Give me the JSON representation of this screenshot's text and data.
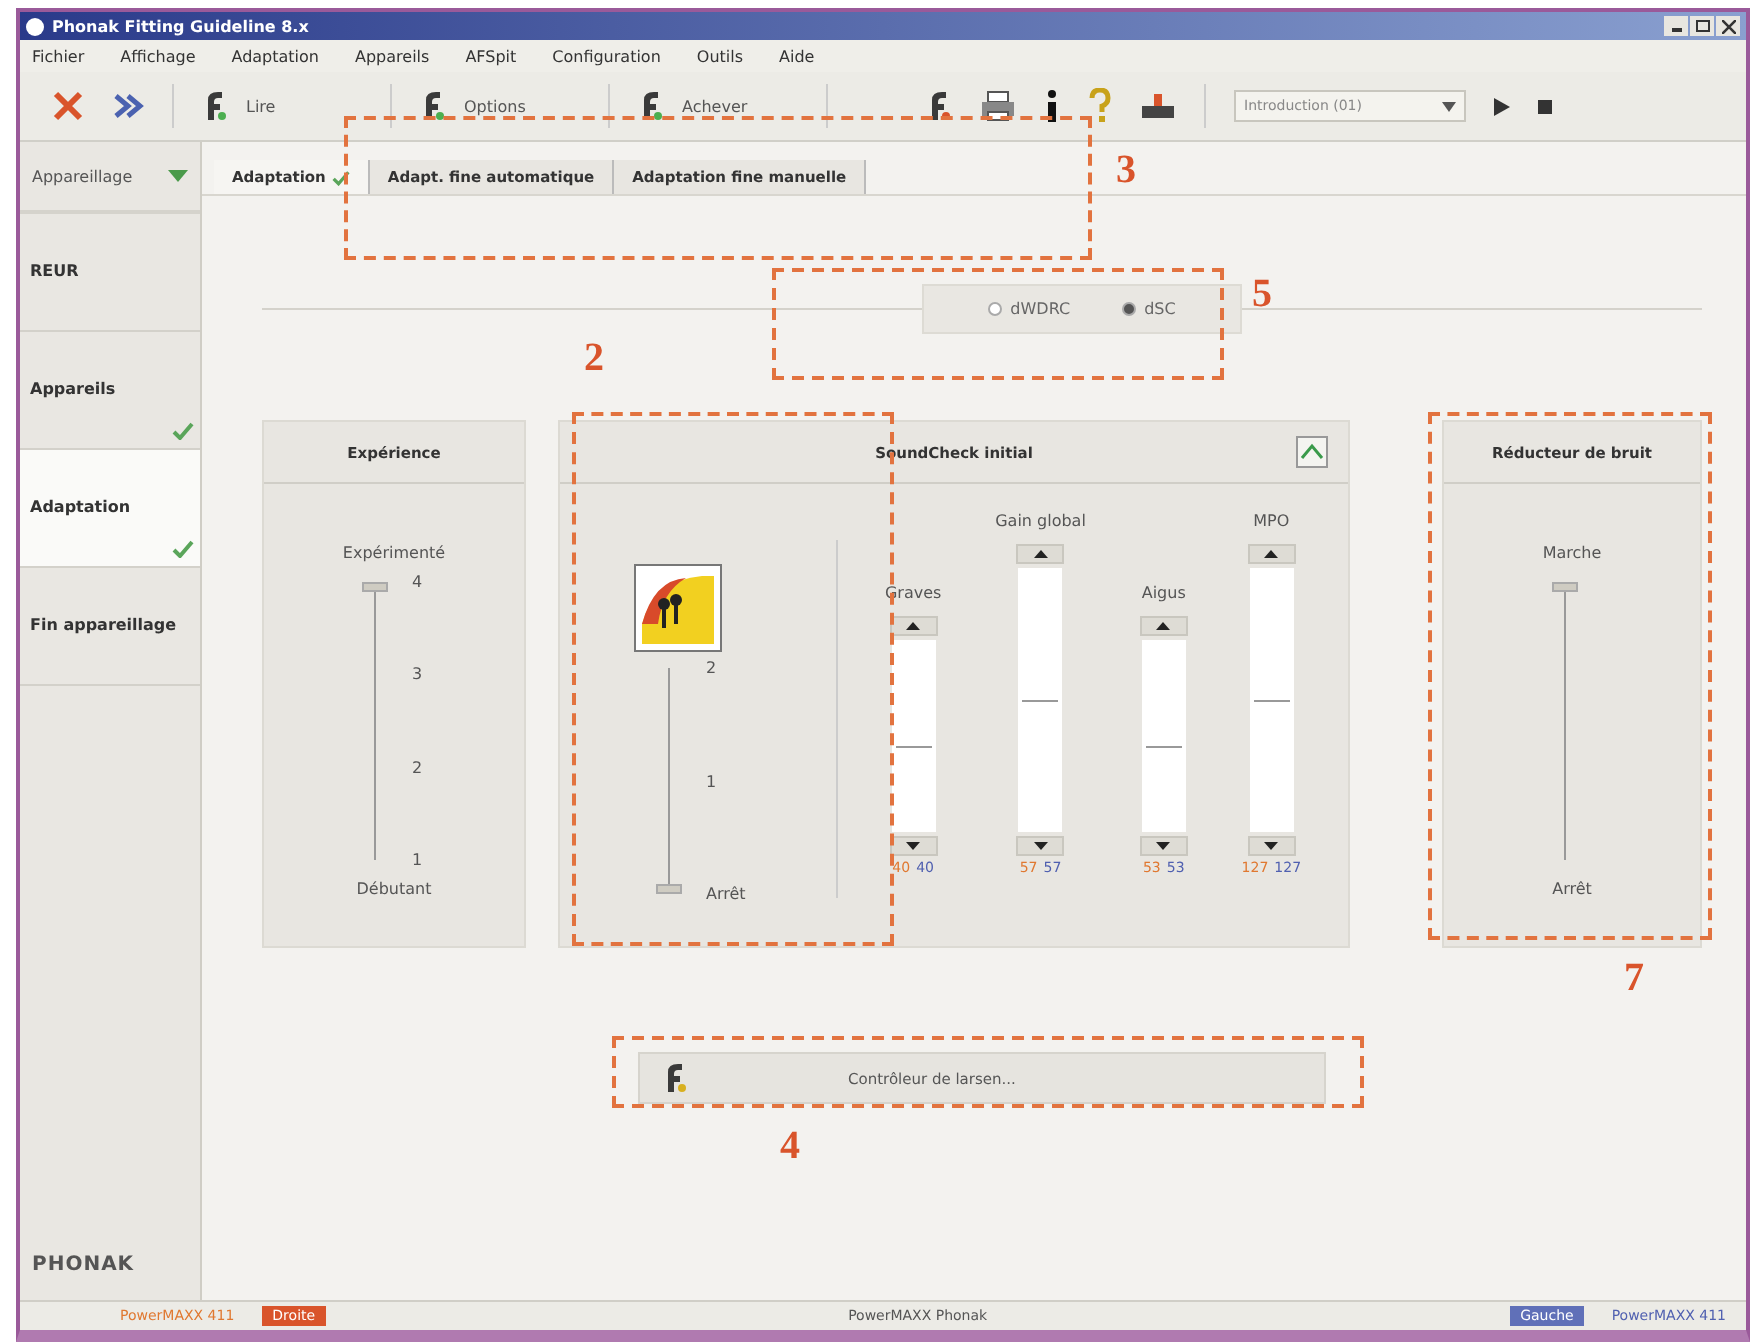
{
  "window": {
    "title": "Phonak Fitting Guideline 8.x"
  },
  "menu": [
    "Fichier",
    "Affichage",
    "Adaptation",
    "Appareils",
    "AFSpit",
    "Configuration",
    "Outils",
    "Aide"
  ],
  "toolbar": {
    "labeled_buttons": [
      "Lire",
      "Options",
      "Achever"
    ],
    "program_select": {
      "value": "Introduction (01)"
    }
  },
  "sidebar": {
    "header": "Appareillage",
    "items": [
      {
        "label": "REUR",
        "done": false,
        "selected": false
      },
      {
        "label": "Appareils",
        "done": true,
        "selected": false
      },
      {
        "label": "Adaptation",
        "done": true,
        "selected": true
      },
      {
        "label": "Fin appareillage",
        "done": false,
        "selected": false
      }
    ],
    "logo": "PHONAK"
  },
  "tabs": [
    {
      "label": "Adaptation",
      "done": true,
      "selected": true
    },
    {
      "label": "Adapt. fine automatique",
      "done": false,
      "selected": false
    },
    {
      "label": "Adaptation fine manuelle",
      "done": false,
      "selected": false
    }
  ],
  "mode_options": [
    {
      "label": "dWDRC",
      "selected": false
    },
    {
      "label": "dSC",
      "selected": true
    }
  ],
  "experience_panel": {
    "title": "Expérience",
    "top_label": "Expérimenté",
    "ticks": [
      "4",
      "3",
      "2",
      "1"
    ],
    "bottom_label": "Débutant",
    "level": 1
  },
  "comfort_panel": {
    "ticks": [
      "2",
      "1",
      "Arrêt"
    ],
    "level": 0
  },
  "soundcheck_panel": {
    "title": "SoundCheck initial",
    "sliders": [
      {
        "label": "Graves",
        "kind": "short",
        "level": 0.45,
        "left_value": "40",
        "right_value": "40"
      },
      {
        "label": "Gain global",
        "kind": "tall",
        "level": 0.5,
        "left_value": "57",
        "right_value": "57"
      },
      {
        "label": "Aigus",
        "kind": "short",
        "level": 0.45,
        "left_value": "53",
        "right_value": "53"
      },
      {
        "label": "MPO",
        "kind": "tall",
        "level": 0.5,
        "left_value": "127",
        "right_value": "127"
      }
    ]
  },
  "noise_panel": {
    "title": "Réducteur de bruit",
    "top_label": "Marche",
    "bottom_label": "Arrêt",
    "level": 1
  },
  "feedback_button": {
    "label": "Contrôleur de larsen..."
  },
  "status_bar": {
    "left_device": "PowerMAXX 411",
    "left_badge": "Droite",
    "center": "PowerMAXX Phonak",
    "right_badge": "Gauche",
    "right_device": "PowerMAXX 411"
  },
  "annotations": [
    {
      "label": "3"
    },
    {
      "label": "5"
    },
    {
      "label": "2"
    },
    {
      "label": "7"
    },
    {
      "label": "4"
    }
  ]
}
